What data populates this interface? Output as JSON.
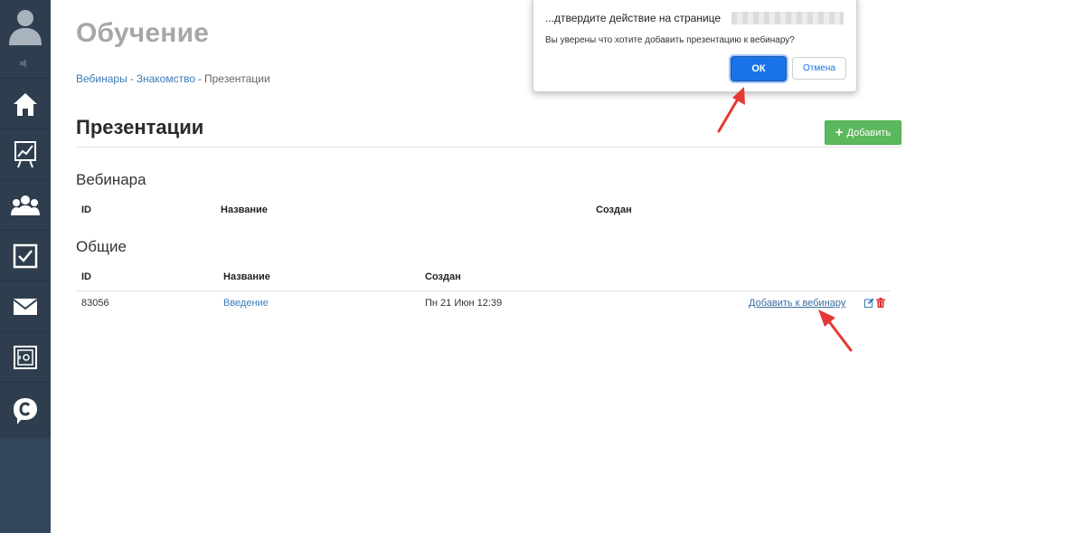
{
  "sidebar": {
    "items": [
      {
        "icon": "home-icon"
      },
      {
        "icon": "chart-board-icon"
      },
      {
        "icon": "users-icon"
      },
      {
        "icon": "checkbox-icon"
      },
      {
        "icon": "mail-icon"
      },
      {
        "icon": "safe-icon"
      },
      {
        "icon": "logo-c-icon"
      }
    ]
  },
  "page": {
    "title": "Обучение"
  },
  "breadcrumb": {
    "items": [
      "Вебинары",
      "Знакомство",
      "Презентации"
    ],
    "separator": "-"
  },
  "section": {
    "title": "Презентации",
    "add_label": "Добавить"
  },
  "webinar_group": {
    "title": "Вебинара",
    "columns": [
      "ID",
      "Название",
      "Создан"
    ]
  },
  "common_group": {
    "title": "Общие",
    "columns": [
      "ID",
      "Название",
      "Создан"
    ],
    "rows": [
      {
        "id": "83056",
        "name": "Введение",
        "created": "Пн 21 Июн 12:39",
        "action": "Добавить к вебинару"
      }
    ]
  },
  "dialog": {
    "title": "...дтвердите действие на странице",
    "message": "Вы уверены что хотите добавить презентацию к вебинару?",
    "ok_label": "ОК",
    "cancel_label": "Отмена"
  },
  "colors": {
    "sidebar": "#2e3e4e",
    "link": "#3a7bb8",
    "add_button": "#5cb85c",
    "ok_button": "#1a73e8",
    "annotation_arrow": "#e53935"
  }
}
